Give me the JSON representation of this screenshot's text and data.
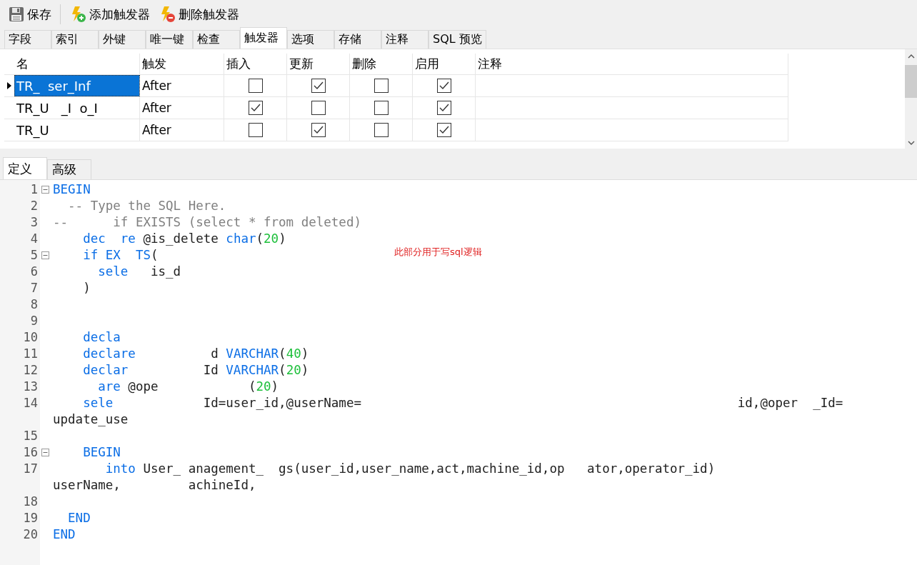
{
  "toolbar": [
    {
      "kind": "save",
      "label": "保存"
    },
    {
      "kind": "add",
      "label": "添加触发器"
    },
    {
      "kind": "remove",
      "label": "删除触发器"
    }
  ],
  "tabs": [
    {
      "label": "字段",
      "selected": false
    },
    {
      "label": "索引",
      "selected": false
    },
    {
      "label": "外键",
      "selected": false
    },
    {
      "label": "唯一键",
      "selected": false
    },
    {
      "label": "检查",
      "selected": false
    },
    {
      "label": "触发器",
      "selected": true
    },
    {
      "label": "选项",
      "selected": false
    },
    {
      "label": "存储",
      "selected": false
    },
    {
      "label": "注释",
      "selected": false
    },
    {
      "label": "SQL 预览",
      "selected": false
    }
  ],
  "triggers": {
    "columns": [
      "名",
      "触发",
      "插入",
      "更新",
      "删除",
      "启用",
      "注释"
    ],
    "rows": [
      {
        "selected": true,
        "name": "TR_  ser_Inf",
        "fire": "After",
        "insert": false,
        "update": true,
        "delete": false,
        "enabled": true
      },
      {
        "selected": false,
        "name": "TR_U   _I  o_I",
        "fire": "After",
        "insert": true,
        "update": false,
        "delete": false,
        "enabled": true
      },
      {
        "selected": false,
        "name": "TR_U",
        "fire": "After",
        "insert": false,
        "update": true,
        "delete": false,
        "enabled": true
      }
    ]
  },
  "editor_tabs": [
    {
      "label": "定义",
      "selected": true
    },
    {
      "label": "高级",
      "selected": false
    }
  ],
  "code_lines": [
    {
      "number": "1",
      "fold": true,
      "tokens": [
        {
          "kind": "keyword",
          "text": "BEGIN"
        }
      ]
    },
    {
      "number": "2",
      "fold": false,
      "tokens": [
        {
          "kind": "comment",
          "text": "  -- Type the SQL Here."
        }
      ]
    },
    {
      "number": "3",
      "fold": false,
      "tokens": [
        {
          "kind": "comment",
          "text": "--      if EXISTS (select * from deleted)"
        }
      ]
    },
    {
      "number": "4",
      "fold": false,
      "tokens": [
        {
          "kind": "keyword",
          "text": "    dec  re"
        },
        {
          "kind": "plain",
          "text": " @is_delete "
        },
        {
          "kind": "keyword",
          "text": "char"
        },
        {
          "kind": "plain",
          "text": "("
        },
        {
          "kind": "number",
          "text": "20"
        },
        {
          "kind": "plain",
          "text": ")"
        }
      ]
    },
    {
      "number": "5",
      "fold": true,
      "tokens": [
        {
          "kind": "keyword",
          "text": "    if EX  TS"
        },
        {
          "kind": "plain",
          "text": "("
        }
      ]
    },
    {
      "number": "6",
      "fold": false,
      "tokens": [
        {
          "kind": "keyword",
          "text": "      sele"
        },
        {
          "kind": "plain",
          "text": "   is_d"
        }
      ]
    },
    {
      "number": "7",
      "fold": false,
      "tokens": [
        {
          "kind": "plain",
          "text": "    )"
        }
      ]
    },
    {
      "number": "8",
      "fold": false
    },
    {
      "number": "9",
      "fold": false
    },
    {
      "number": "10",
      "fold": false,
      "tokens": [
        {
          "kind": "keyword",
          "text": "    decla"
        }
      ]
    },
    {
      "number": "11",
      "fold": false,
      "tokens": [
        {
          "kind": "keyword",
          "text": "    declare"
        },
        {
          "kind": "plain",
          "text": "          d "
        },
        {
          "kind": "keyword",
          "text": "VARCHAR"
        },
        {
          "kind": "plain",
          "text": "("
        },
        {
          "kind": "number",
          "text": "40"
        },
        {
          "kind": "plain",
          "text": ")"
        }
      ]
    },
    {
      "number": "12",
      "fold": false,
      "tokens": [
        {
          "kind": "keyword",
          "text": "    declar"
        },
        {
          "kind": "plain",
          "text": "          Id "
        },
        {
          "kind": "keyword",
          "text": "VARCHAR"
        },
        {
          "kind": "plain",
          "text": "("
        },
        {
          "kind": "number",
          "text": "20"
        },
        {
          "kind": "plain",
          "text": ")"
        }
      ]
    },
    {
      "number": "13",
      "fold": false,
      "tokens": [
        {
          "kind": "keyword",
          "text": "      are"
        },
        {
          "kind": "plain",
          "text": " @ope            ("
        },
        {
          "kind": "number",
          "text": "20"
        },
        {
          "kind": "plain",
          "text": ")"
        }
      ]
    },
    {
      "number": "14",
      "fold": false,
      "tokens": [
        {
          "kind": "keyword",
          "text": "    sele"
        },
        {
          "kind": "plain",
          "text": "            Id=user_id,@userName=                                                  id,@oper  _Id="
        },
        {
          "kind": "break"
        },
        {
          "kind": "plain",
          "text": "update_use"
        }
      ]
    },
    {
      "number": "15",
      "fold": false
    },
    {
      "number": "16",
      "fold": true,
      "tokens": [
        {
          "kind": "keyword",
          "text": "    BEGIN"
        }
      ]
    },
    {
      "number": "17",
      "fold": false,
      "tokens": [
        {
          "kind": "keyword",
          "text": "       into"
        },
        {
          "kind": "plain",
          "text": " User_ anagement_  gs(user_id,user_name,act,machine_id,op   ator,operator_id)"
        },
        {
          "kind": "break"
        },
        {
          "kind": "plain",
          "text": "userName,         achineId,"
        }
      ]
    },
    {
      "number": "18",
      "fold": false
    },
    {
      "number": "19",
      "fold": false,
      "tokens": [
        {
          "kind": "keyword",
          "text": "  END"
        }
      ]
    },
    {
      "number": "20",
      "fold": false,
      "tokens": [
        {
          "kind": "keyword",
          "text": "END"
        }
      ]
    }
  ],
  "annotation": "此部分用于写sql逻辑"
}
